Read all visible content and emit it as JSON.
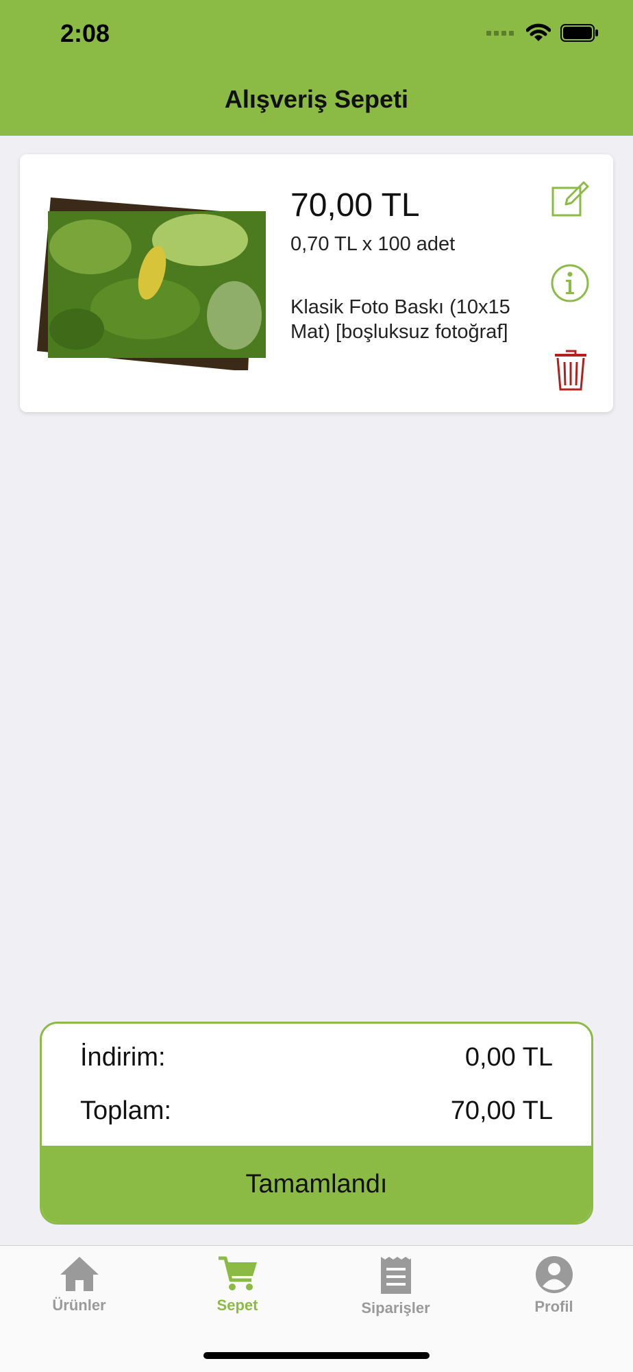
{
  "status_bar": {
    "time": "2:08"
  },
  "header": {
    "title": "Alışveriş Sepeti"
  },
  "cart_item": {
    "price": "70,00 TL",
    "unit_line": "0,70 TL x 100 adet",
    "description": "Klasik Foto Baskı (10x15 Mat) [boşluksuz fotoğraf]",
    "icons": [
      "edit-icon",
      "info-icon",
      "trash-icon"
    ]
  },
  "summary": {
    "discount_label": "İndirim:",
    "discount_value": "0,00 TL",
    "total_label": "Toplam:",
    "total_value": "70,00 TL",
    "complete_label": "Tamamlandı"
  },
  "tabs": [
    {
      "label": "Ürünler",
      "icon": "home-icon",
      "active": false
    },
    {
      "label": "Sepet",
      "icon": "cart-icon",
      "active": true
    },
    {
      "label": "Siparişler",
      "icon": "receipt-icon",
      "active": false
    },
    {
      "label": "Profil",
      "icon": "person-icon",
      "active": false
    }
  ],
  "colors": {
    "accent": "#8bbb45",
    "danger": "#b3201c",
    "inactive": "#9a9a9a"
  }
}
